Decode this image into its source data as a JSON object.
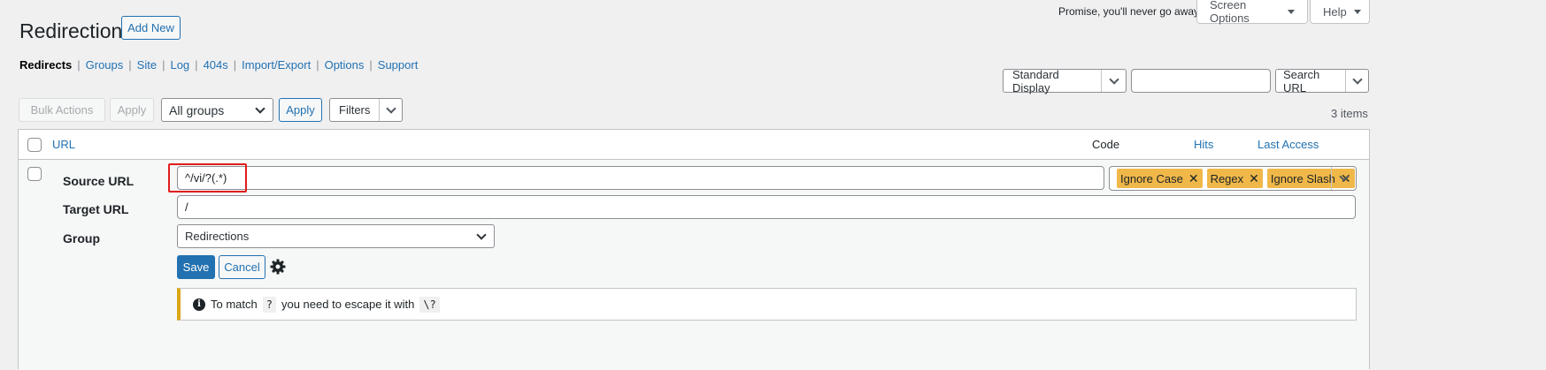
{
  "header": {
    "title": "Redirections",
    "add_new": "Add New",
    "promise": "Promise, you'll never go away",
    "screen_options": "Screen Options",
    "help": "Help"
  },
  "subnav": [
    {
      "label": "Redirects",
      "current": true
    },
    {
      "label": "Groups"
    },
    {
      "label": "Site"
    },
    {
      "label": "Log"
    },
    {
      "label": "404s"
    },
    {
      "label": "Import/Export"
    },
    {
      "label": "Options"
    },
    {
      "label": "Support"
    }
  ],
  "toolbar": {
    "display_select": "Standard Display",
    "search_value": "",
    "search_button": "Search URL",
    "bulk_actions": "Bulk Actions",
    "apply_disabled": "Apply",
    "groups_select": "All groups",
    "apply": "Apply",
    "filters": "Filters",
    "items_count": "3 items"
  },
  "table": {
    "columns": {
      "url": "URL",
      "code": "Code",
      "hits": "Hits",
      "last_access": "Last Access"
    }
  },
  "edit_row": {
    "source_label": "Source URL",
    "source_value": "^/vi/?(.*)",
    "target_label": "Target URL",
    "target_value": "/",
    "group_label": "Group",
    "group_value": "Redirections",
    "flags": [
      "Ignore Case",
      "Regex",
      "Ignore Slash"
    ],
    "save": "Save",
    "cancel": "Cancel",
    "notice": {
      "prefix": "To match",
      "code1": "?",
      "middle": "you need to escape it with",
      "code2": "\\?"
    }
  },
  "colors": {
    "accent": "#2271b1",
    "tag_bg": "#f0b849",
    "highlight_box": "#e11d1d",
    "notice_border": "#dba617"
  }
}
